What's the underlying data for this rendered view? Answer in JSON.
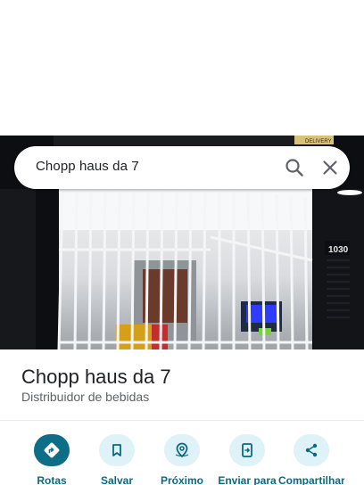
{
  "search": {
    "query": "Chopp haus da 7"
  },
  "photo": {
    "house_number": "1030",
    "sign_text": "DELIVERY"
  },
  "place": {
    "name": "Chopp haus da 7",
    "category": "Distribuidor de bebidas"
  },
  "actions": [
    {
      "label": "Rotas",
      "icon": "directions-icon"
    },
    {
      "label": "Salvar",
      "icon": "bookmark-icon"
    },
    {
      "label": "Próximo",
      "icon": "nearby-icon"
    },
    {
      "label": "Enviar para",
      "icon": "send-to-phone-icon"
    },
    {
      "label": "Compartilhar",
      "icon": "share-icon"
    }
  ],
  "colors": {
    "primary_action": "#0e6e87",
    "secondary_action_bg": "#dff2f8",
    "action_label": "#0b6a80"
  }
}
